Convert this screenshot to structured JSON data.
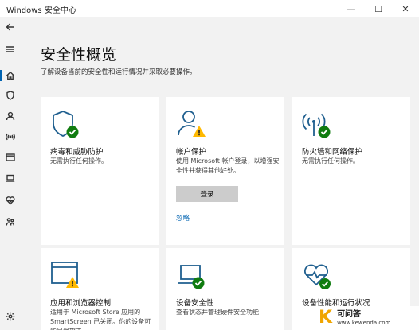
{
  "window": {
    "title": "Windows 安全中心",
    "controls": {
      "minimize": "—",
      "maximize": "☐",
      "close": "✕"
    }
  },
  "nav": {
    "items": [
      {
        "name": "back",
        "icon": "back-arrow-icon"
      },
      {
        "name": "menu",
        "icon": "hamburger-menu-icon"
      },
      {
        "name": "home",
        "icon": "home-icon",
        "active": true
      },
      {
        "name": "virus-protection",
        "icon": "shield-icon"
      },
      {
        "name": "account",
        "icon": "person-icon"
      },
      {
        "name": "firewall",
        "icon": "wireless-icon"
      },
      {
        "name": "app-browser",
        "icon": "browser-window-icon"
      },
      {
        "name": "device-security",
        "icon": "laptop-icon"
      },
      {
        "name": "device-health",
        "icon": "heart-icon"
      },
      {
        "name": "family",
        "icon": "family-icon"
      },
      {
        "name": "settings",
        "icon": "gear-icon"
      }
    ]
  },
  "main": {
    "title": "安全性概览",
    "subtitle": "了解设备当前的安全性和运行情况并采取必要操作。",
    "tiles": [
      {
        "title": "病毒和威胁防护",
        "desc": "无需执行任何操作。",
        "status": "ok"
      },
      {
        "title": "帐户保护",
        "desc": "使用 Microsoft 帐户登录，以增强安全性并获得其他好处。",
        "status": "warning",
        "button": "登录",
        "link": "忽略"
      },
      {
        "title": "防火墙和网络保护",
        "desc": "无需执行任何操作。",
        "status": "ok"
      },
      {
        "title": "应用和浏览器控制",
        "desc": "适用于 Microsoft Store 应用的 SmartScreen 已关闭。你的设备可能易受攻击。",
        "status": "warning"
      },
      {
        "title": "设备安全性",
        "desc": "查看状态并管理硬件安全功能",
        "status": "ok"
      },
      {
        "title": "设备性能和运行状况",
        "desc": "",
        "status": "ok"
      }
    ]
  },
  "watermark": {
    "letter": "K",
    "name": "可问答",
    "url": "www.kewenda.com"
  },
  "colors": {
    "accent": "#0063b1",
    "ok": "#107c10",
    "warning": "#ffb900",
    "icon": "#1f5f8f"
  }
}
